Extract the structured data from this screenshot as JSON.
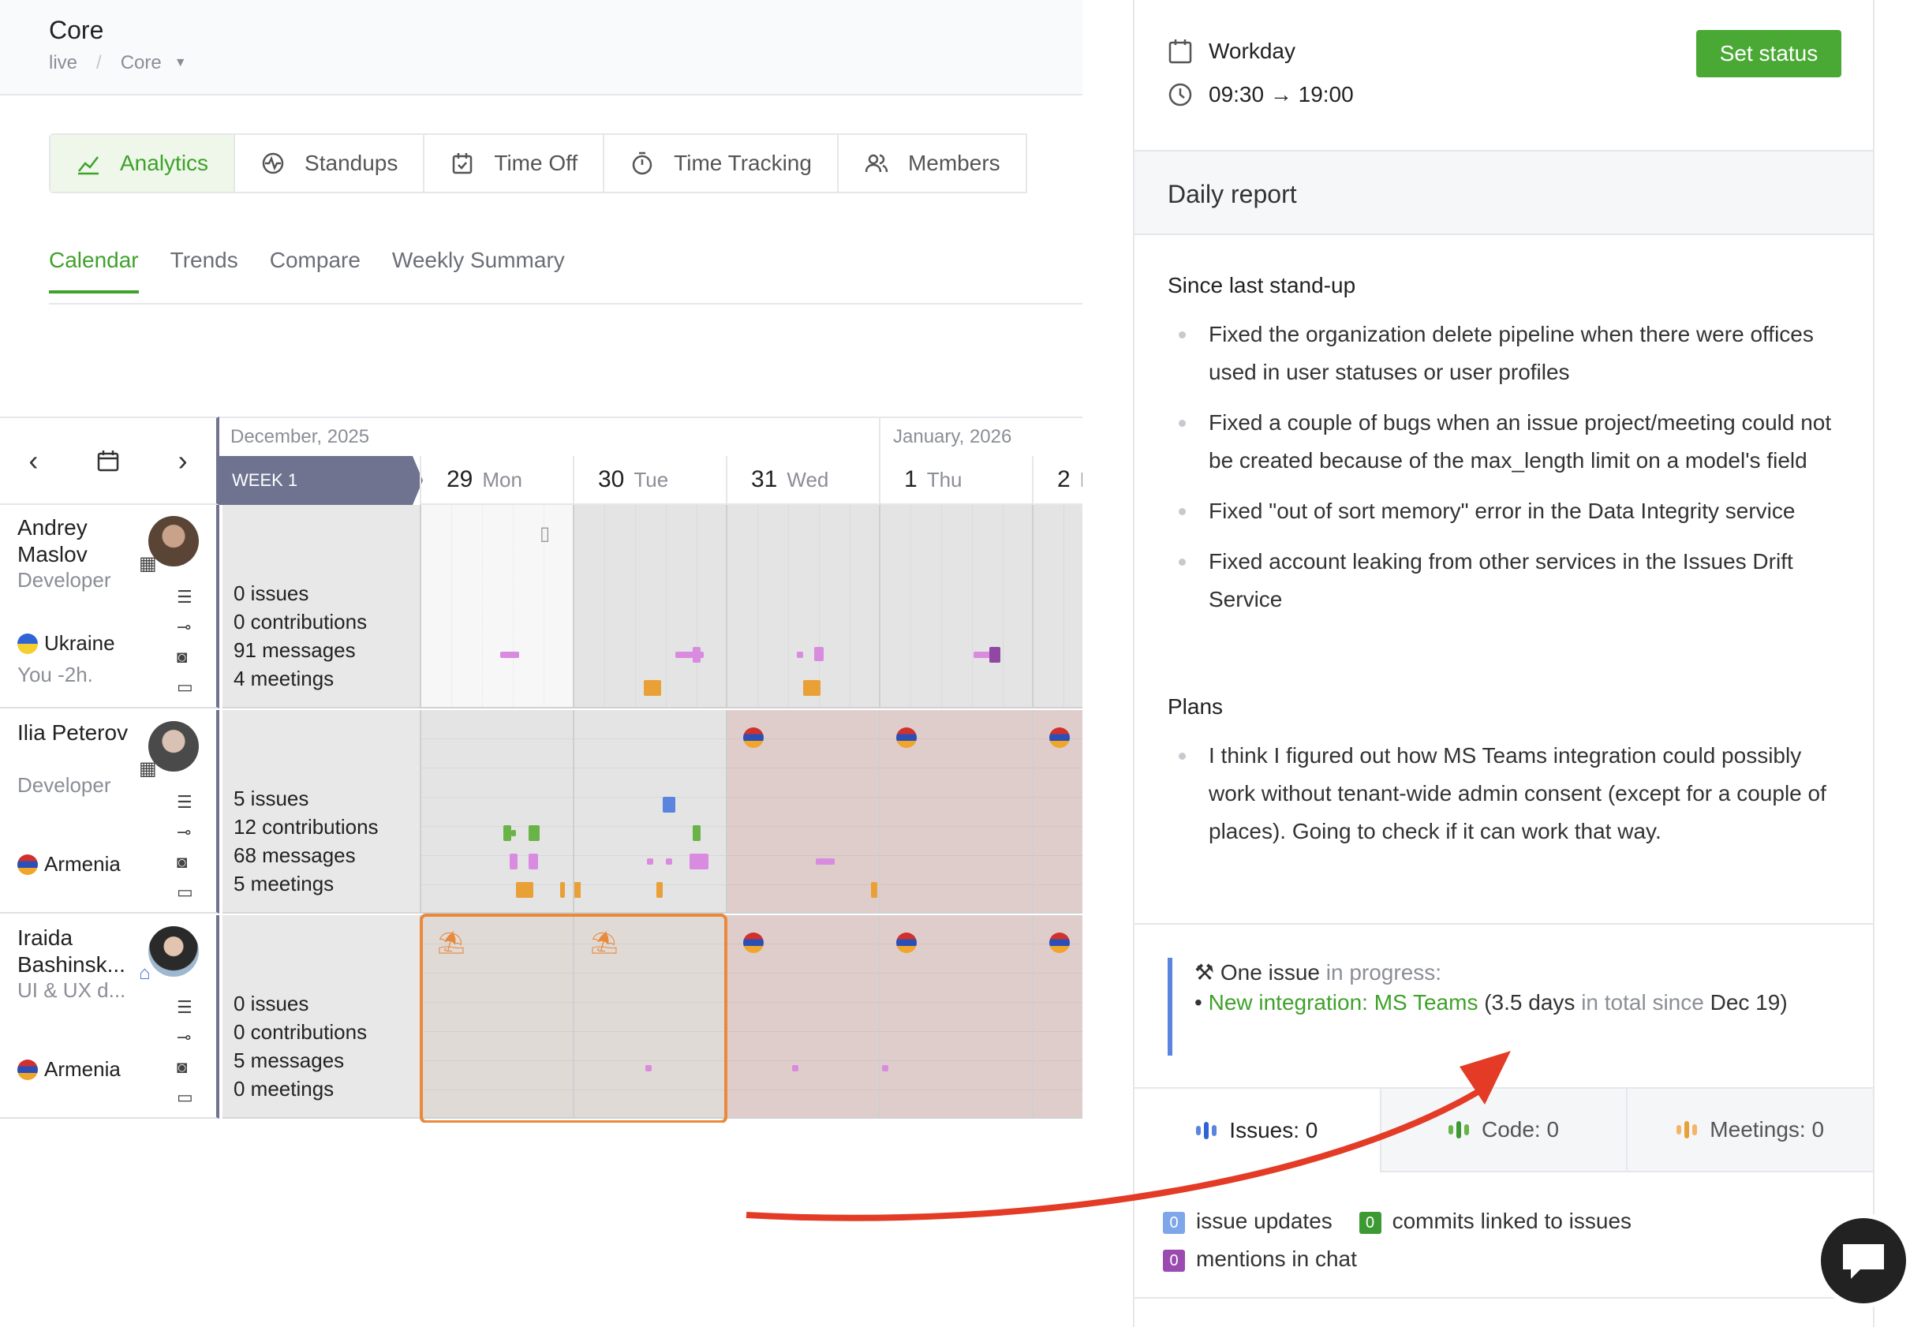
{
  "header": {
    "title": "Core",
    "breadcrumb": [
      "live",
      "Core"
    ],
    "chevron_icon": "chevron-down-icon"
  },
  "main_tabs": [
    {
      "label": "Analytics",
      "icon": "analytics-icon",
      "active": true
    },
    {
      "label": "Standups",
      "icon": "standups-icon",
      "active": false
    },
    {
      "label": "Time Off",
      "icon": "calendar-check-icon",
      "active": false
    },
    {
      "label": "Time Tracking",
      "icon": "stopwatch-icon",
      "active": false
    },
    {
      "label": "Members",
      "icon": "members-icon",
      "active": false
    }
  ],
  "sub_tabs": [
    {
      "label": "Calendar",
      "active": true
    },
    {
      "label": "Trends",
      "active": false
    },
    {
      "label": "Compare",
      "active": false
    },
    {
      "label": "Weekly Summary",
      "active": false
    }
  ],
  "calendar": {
    "prev": "‹",
    "next": "›",
    "months": [
      "December, 2025",
      "January, 2026"
    ],
    "week_label": "WEEK 1",
    "days": [
      {
        "num": "29",
        "dow": "Mon"
      },
      {
        "num": "30",
        "dow": "Tue"
      },
      {
        "num": "31",
        "dow": "Wed"
      },
      {
        "num": "1",
        "dow": "Thu"
      },
      {
        "num": "2",
        "dow": "F"
      }
    ],
    "people": [
      {
        "name": "Andrey Maslov",
        "role": "Developer",
        "country": "Ukraine",
        "local": "You -2h.",
        "stats": [
          "0 issues",
          "0 contributions",
          "91 messages",
          "4 meetings"
        ]
      },
      {
        "name": "Ilia Peterov",
        "role": "Developer",
        "country": "Armenia",
        "local": "",
        "stats": [
          "5 issues",
          "12 contributions",
          "68 messages",
          "5 meetings"
        ]
      },
      {
        "name": "Iraida Bashinsk...",
        "role": "UI & UX d...",
        "country": "Armenia",
        "local": "",
        "stats": [
          "0 issues",
          "0 contributions",
          "5 messages",
          "0 meetings"
        ]
      }
    ]
  },
  "panel": {
    "workday_label": "Workday",
    "hours": "09:30 → 19:00",
    "set_status": "Set status",
    "section_title": "Daily report",
    "since_title": "Since last stand-up",
    "since_items": [
      "Fixed the organization delete pipeline when there were offices used in user statuses or user profiles",
      "Fixed a couple of bugs when an issue project/meeting could not be created because of the max_length limit on a model's field",
      "Fixed \"out of sort memory\" error in the Data Integrity service",
      "Fixed account leaking from other services in the Issues Drift Service"
    ],
    "plans_title": "Plans",
    "plans_items": [
      "I think I figured out how MS Teams integration could possibly work without tenant-wide admin consent (except for a couple of places). Going to check if it can work that way."
    ],
    "issue_line1_a": "One issue",
    "issue_line1_b": "in progress:",
    "issue_link": "New integration: MS Teams",
    "issue_days": "(3.5 days",
    "issue_total": "in total since",
    "issue_since": "Dec 19)",
    "tabs": [
      {
        "label": "Issues: 0",
        "active": true
      },
      {
        "label": "Code: 0",
        "active": false
      },
      {
        "label": "Meetings: 0",
        "active": false
      }
    ],
    "legend": [
      {
        "count": "0",
        "label": "issue updates",
        "color": "#7ea6e8"
      },
      {
        "count": "0",
        "label": "commits linked to issues",
        "color": "#3d9a33"
      },
      {
        "count": "0",
        "label": "mentions in chat",
        "color": "#9b4bb0"
      }
    ]
  },
  "colors": {
    "accent": "#3fa12a",
    "button": "#4aa934",
    "week": "#6f7390",
    "vacation": "#e8893b",
    "arrow": "#e33b25"
  }
}
